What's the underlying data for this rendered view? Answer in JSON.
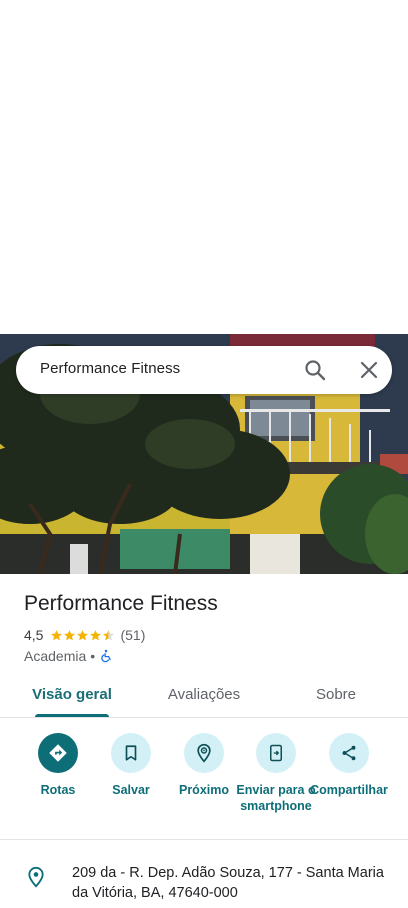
{
  "search": {
    "query": "Performance Fitness",
    "search_icon": "search-icon",
    "close_icon": "close-icon"
  },
  "place": {
    "name": "Performance Fitness",
    "rating": "4,5",
    "stars": 4.5,
    "review_count": "(51)",
    "category": "Academia",
    "separator": "•",
    "accessibility_icon": "wheelchair-icon"
  },
  "tabs": [
    {
      "label": "Visão geral",
      "active": true
    },
    {
      "label": "Avaliações",
      "active": false
    },
    {
      "label": "Sobre",
      "active": false
    }
  ],
  "actions": [
    {
      "label": "Rotas",
      "icon": "directions-icon"
    },
    {
      "label": "Salvar",
      "icon": "bookmark-icon"
    },
    {
      "label": "Próximo",
      "icon": "nearby-icon"
    },
    {
      "label": "Enviar para o smartphone",
      "icon": "send-to-phone-icon"
    },
    {
      "label": "Compartilhar",
      "icon": "share-icon"
    }
  ],
  "address": {
    "text": "209 da - R. Dep. Adão Souza, 177 - Santa Maria da Vitória, BA, 47640-000",
    "icon": "location-pin-icon"
  },
  "colors": {
    "accent": "#0e6e78",
    "accent_light": "#d3f0f7",
    "star": "#f5b400"
  }
}
